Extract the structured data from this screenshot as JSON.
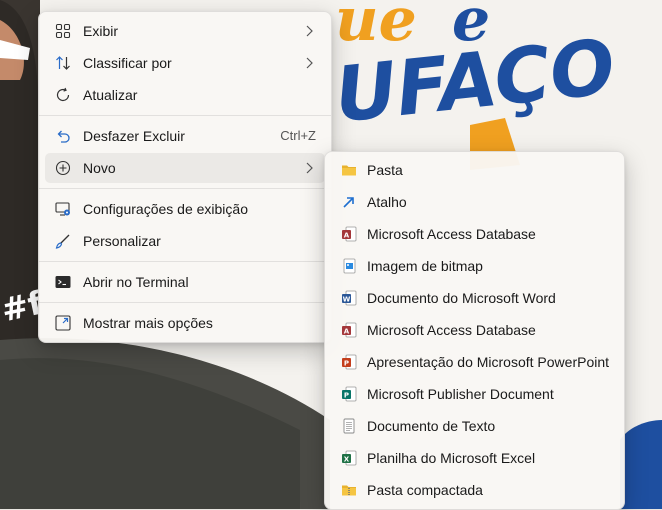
{
  "main_menu": {
    "items": [
      {
        "label": "Exibir",
        "icon": "grid-view-icon",
        "submenu": true
      },
      {
        "label": "Classificar por",
        "icon": "sort-icon",
        "submenu": true
      },
      {
        "label": "Atualizar",
        "icon": "refresh-icon"
      },
      {
        "label": "Desfazer Excluir",
        "icon": "undo-icon",
        "shortcut": "Ctrl+Z"
      },
      {
        "label": "Novo",
        "icon": "new-plus-icon",
        "submenu": true,
        "highlighted": true
      },
      {
        "label": "Configurações de exibição",
        "icon": "display-settings-icon"
      },
      {
        "label": "Personalizar",
        "icon": "brush-icon"
      },
      {
        "label": "Abrir no Terminal",
        "icon": "terminal-icon"
      },
      {
        "label": "Mostrar mais opções",
        "icon": "more-options-icon"
      }
    ]
  },
  "new_submenu": {
    "items": [
      {
        "label": "Pasta",
        "icon": "folder-icon"
      },
      {
        "label": "Atalho",
        "icon": "shortcut-icon"
      },
      {
        "label": "Microsoft Access Database",
        "icon": "access-icon"
      },
      {
        "label": "Imagem de bitmap",
        "icon": "bitmap-icon"
      },
      {
        "label": "Documento do Microsoft Word",
        "icon": "word-icon"
      },
      {
        "label": "Microsoft Access Database",
        "icon": "access-icon"
      },
      {
        "label": "Apresentação do Microsoft PowerPoint",
        "icon": "powerpoint-icon"
      },
      {
        "label": "Microsoft Publisher Document",
        "icon": "publisher-icon"
      },
      {
        "label": "Documento de Texto",
        "icon": "text-document-icon"
      },
      {
        "label": "Planilha do Microsoft Excel",
        "icon": "excel-icon"
      },
      {
        "label": "Pasta compactada",
        "icon": "zip-folder-icon"
      }
    ]
  },
  "colors": {
    "brand_blue": "#1e4fa0",
    "brand_orange": "#f0a020",
    "word": "#2b5797",
    "excel": "#1e7145",
    "powerpoint": "#c43e1c",
    "access": "#a4373a",
    "publisher": "#077568",
    "folder": "#f5c542"
  }
}
